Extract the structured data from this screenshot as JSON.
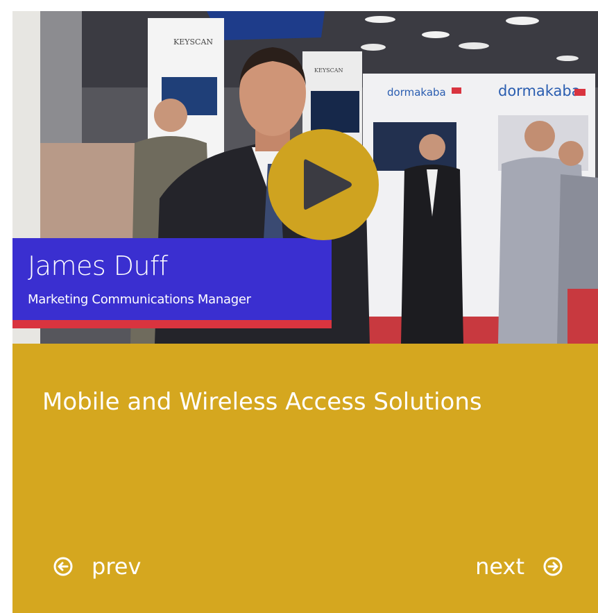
{
  "video": {
    "presenter_name": "James Duff",
    "presenter_title": "Marketing Communications Manager",
    "booth_signs": [
      "KEYSCAN",
      "KEYSCAN",
      "dormakaba",
      "dormakaba"
    ],
    "play_icon": "play-icon",
    "overlay_colors": {
      "band": "#3a2fd0",
      "stripe": "#d9343f",
      "play": "#cfa320"
    }
  },
  "info": {
    "title": "Mobile and Wireless Access Solutions",
    "background": "#d5a71f",
    "prev": {
      "label": "prev",
      "icon": "circle-arrow-left-icon"
    },
    "next": {
      "label": "next",
      "icon": "circle-arrow-right-icon"
    }
  }
}
